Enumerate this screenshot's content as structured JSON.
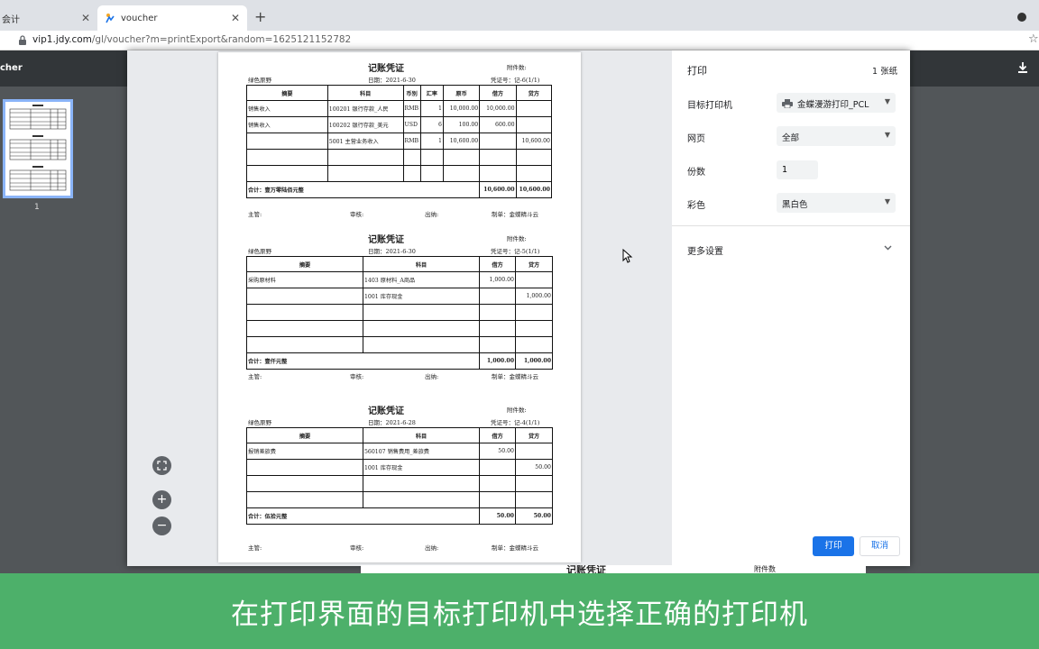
{
  "browser": {
    "tab1_title": "会计",
    "tab2_title": "voucher",
    "url_host": "vip1.jdy.com",
    "url_path": "/gl/voucher?m=printExport&random=1625121152782"
  },
  "viewer": {
    "title": "cher",
    "thumbnail_page": "1"
  },
  "vouchers": [
    {
      "title": "记账凭证",
      "attach": "附件数:",
      "company": "绿色原野",
      "date": "日期：2021-6-30",
      "number": "凭证号：记-6(1/1)",
      "headers": [
        "摘要",
        "科目",
        "币别",
        "汇率",
        "原币",
        "借方",
        "贷方"
      ],
      "rows": [
        [
          "销售收入",
          "100201 银行存款_人民",
          "RMB",
          "1",
          "10,000.00",
          "10,000.00",
          ""
        ],
        [
          "销售收入",
          "100202 银行存款_美元",
          "USD",
          "6",
          "100.00",
          "600.00",
          ""
        ],
        [
          "",
          "5001 主营业务收入",
          "RMB",
          "1",
          "10,600.00",
          "",
          "10,600.00"
        ],
        [
          "",
          "",
          "",
          "",
          "",
          "",
          ""
        ],
        [
          "",
          "",
          "",
          "",
          "",
          "",
          ""
        ]
      ],
      "total_label": "合计：壹万零陆佰元整",
      "total_debit": "10,600.00",
      "total_credit": "10,600.00",
      "foot": [
        "主管:",
        "审核:",
        "出纳:",
        "制单：金蝶精斗云"
      ]
    },
    {
      "title": "记账凭证",
      "attach": "附件数:",
      "company": "绿色原野",
      "date": "日期：2021-6-30",
      "number": "凭证号：记-5(1/1)",
      "headers": [
        "摘要",
        "科目",
        "借方",
        "贷方"
      ],
      "rows": [
        [
          "采购原材料",
          "1403 原材料_A商品",
          "1,000.00",
          ""
        ],
        [
          "",
          "1001 库存现金",
          "",
          "1,000.00"
        ],
        [
          "",
          "",
          "",
          ""
        ],
        [
          "",
          "",
          "",
          ""
        ],
        [
          "",
          "",
          "",
          ""
        ]
      ],
      "total_label": "合计：壹仟元整",
      "total_debit": "1,000.00",
      "total_credit": "1,000.00",
      "foot": [
        "主管:",
        "审核:",
        "出纳:",
        "制单：金蝶精斗云"
      ]
    },
    {
      "title": "记账凭证",
      "attach": "附件数:",
      "company": "绿色原野",
      "date": "日期：2021-6-28",
      "number": "凭证号：记-4(1/1)",
      "headers": [
        "摘要",
        "科目",
        "借方",
        "贷方"
      ],
      "rows": [
        [
          "报销差旅费",
          "560107 销售费用_差旅费",
          "50.00",
          ""
        ],
        [
          "",
          "1001 库存现金",
          "",
          "50.00"
        ],
        [
          "",
          "",
          "",
          ""
        ],
        [
          "",
          "",
          "",
          ""
        ]
      ],
      "total_label": "合计：伍拾元整",
      "total_debit": "50.00",
      "total_credit": "50.00",
      "foot": [
        "主管:",
        "审核:",
        "出纳:",
        "制单：金蝶精斗云"
      ]
    }
  ],
  "peek": {
    "title": "记账凭证",
    "attach": "附件数"
  },
  "print": {
    "title": "打印",
    "sheets": "1 张纸",
    "printer_label": "目标打印机",
    "printer_value": "金蝶漫游打印_PCL",
    "pages_label": "网页",
    "pages_value": "全部",
    "copies_label": "份数",
    "copies_value": "1",
    "color_label": "彩色",
    "color_value": "黑白色",
    "more_label": "更多设置",
    "print_button": "打印",
    "cancel_button": "取消"
  },
  "caption": "在打印界面的目标打印机中选择正确的打印机",
  "colors": {
    "accent": "#1a73e8",
    "banner": "#4db06a",
    "viewer_bg": "#525659"
  }
}
